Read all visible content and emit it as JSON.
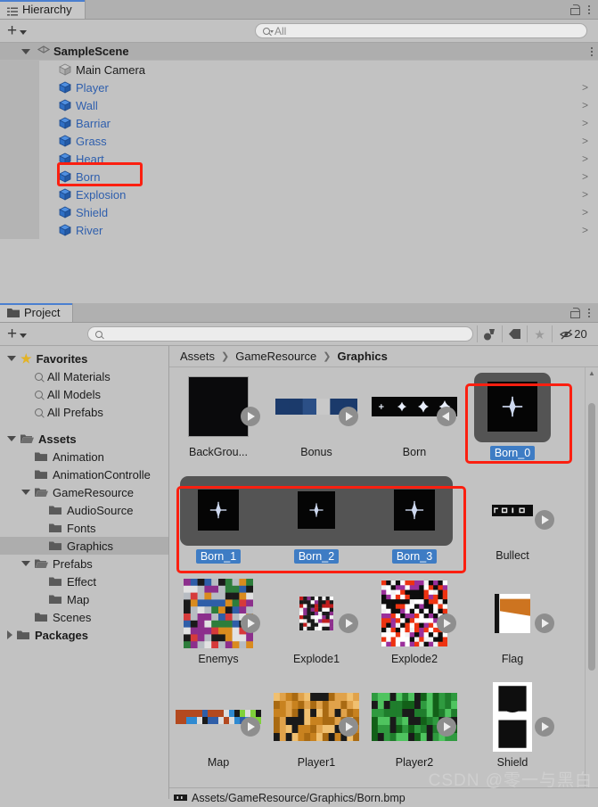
{
  "hierarchy": {
    "tab_label": "Hierarchy",
    "tab_icon": "hierarchy-icon",
    "add_label": "+",
    "search_placeholder": "All",
    "search_value": "",
    "scene_name": "SampleScene",
    "items": [
      {
        "label": "Main Camera",
        "type": "camera",
        "chevron": ""
      },
      {
        "label": "Player",
        "type": "prefab",
        "chevron": ">"
      },
      {
        "label": "Wall",
        "type": "prefab",
        "chevron": ">"
      },
      {
        "label": "Barriar",
        "type": "prefab",
        "chevron": ">"
      },
      {
        "label": "Grass",
        "type": "prefab",
        "chevron": ">"
      },
      {
        "label": "Heart",
        "type": "prefab",
        "chevron": ">"
      },
      {
        "label": "Born",
        "type": "prefab",
        "chevron": ">"
      },
      {
        "label": "Explosion",
        "type": "prefab",
        "chevron": ">"
      },
      {
        "label": "Shield",
        "type": "prefab",
        "chevron": ">"
      },
      {
        "label": "River",
        "type": "prefab",
        "chevron": ">"
      }
    ]
  },
  "project": {
    "tab_label": "Project",
    "add_label": "+",
    "search_placeholder": "",
    "search_value": "",
    "hidden_count": "20",
    "tree": [
      {
        "label": "Favorites",
        "kind": "favorites",
        "indent": 0,
        "arrow": "down",
        "bold": true
      },
      {
        "label": "All Materials",
        "kind": "search",
        "indent": 1,
        "arrow": "",
        "bold": false
      },
      {
        "label": "All Models",
        "kind": "search",
        "indent": 1,
        "arrow": "",
        "bold": false
      },
      {
        "label": "All Prefabs",
        "kind": "search",
        "indent": 1,
        "arrow": "",
        "bold": false
      },
      {
        "label": "",
        "kind": "spacer",
        "indent": 0,
        "arrow": "",
        "bold": false
      },
      {
        "label": "Assets",
        "kind": "folder-open",
        "indent": 0,
        "arrow": "down",
        "bold": true
      },
      {
        "label": "Animation",
        "kind": "folder",
        "indent": 1,
        "arrow": "",
        "bold": false
      },
      {
        "label": "AnimationControlle",
        "kind": "folder",
        "indent": 1,
        "arrow": "",
        "bold": false
      },
      {
        "label": "GameResource",
        "kind": "folder-open",
        "indent": 1,
        "arrow": "down",
        "bold": false
      },
      {
        "label": "AudioSource",
        "kind": "folder",
        "indent": 2,
        "arrow": "",
        "bold": false
      },
      {
        "label": "Fonts",
        "kind": "folder",
        "indent": 2,
        "arrow": "",
        "bold": false
      },
      {
        "label": "Graphics",
        "kind": "folder",
        "indent": 2,
        "arrow": "",
        "bold": false,
        "selected": true
      },
      {
        "label": "Prefabs",
        "kind": "folder-open",
        "indent": 1,
        "arrow": "down",
        "bold": false
      },
      {
        "label": "Effect",
        "kind": "folder",
        "indent": 2,
        "arrow": "",
        "bold": false
      },
      {
        "label": "Map",
        "kind": "folder",
        "indent": 2,
        "arrow": "",
        "bold": false
      },
      {
        "label": "Scenes",
        "kind": "folder",
        "indent": 1,
        "arrow": "",
        "bold": false
      },
      {
        "label": "Packages",
        "kind": "folder",
        "indent": 0,
        "arrow": "right",
        "bold": true
      }
    ],
    "breadcrumb": [
      {
        "label": "Assets",
        "current": false
      },
      {
        "label": "GameResource",
        "current": false
      },
      {
        "label": "Graphics",
        "current": true
      }
    ],
    "grid_rows": [
      [
        {
          "label": "BackGrou...",
          "art": "background",
          "play": true,
          "selected": false
        },
        {
          "label": "Bonus",
          "art": "bonus",
          "play": true,
          "selected": false
        },
        {
          "label": "Born",
          "art": "bornsheet",
          "play": true,
          "play_left": true,
          "selected": false
        },
        {
          "label": "Born_0",
          "art": "born0",
          "play": false,
          "selected": true
        }
      ],
      [
        {
          "label": "Born_1",
          "art": "born1",
          "play": false,
          "selected": true
        },
        {
          "label": "Born_2",
          "art": "born2",
          "play": false,
          "selected": true
        },
        {
          "label": "Born_3",
          "art": "born3",
          "play": false,
          "selected": true
        },
        {
          "label": "Bullect",
          "art": "bullet",
          "play": true,
          "selected": false
        }
      ],
      [
        {
          "label": "Enemys",
          "art": "enemys",
          "play": true,
          "selected": false
        },
        {
          "label": "Explode1",
          "art": "explode1",
          "play": true,
          "selected": false
        },
        {
          "label": "Explode2",
          "art": "explode2",
          "play": true,
          "selected": false
        },
        {
          "label": "Flag",
          "art": "flag",
          "play": true,
          "selected": false
        }
      ],
      [
        {
          "label": "Map",
          "art": "map",
          "play": true,
          "selected": false
        },
        {
          "label": "Player1",
          "art": "player1",
          "play": true,
          "selected": false
        },
        {
          "label": "Player2",
          "art": "player2",
          "play": true,
          "selected": false
        },
        {
          "label": "Shield",
          "art": "shield",
          "play": true,
          "selected": false
        }
      ]
    ],
    "status_path": "Assets/GameResource/Graphics/Born.bmp"
  },
  "watermark": "CSDN @零一与黑白",
  "colors": {
    "accent_blue": "#3e7cc4",
    "prefab_blue": "#2f5fad",
    "highlight_red": "#fb1f10",
    "panel_bg": "#c2c2c2",
    "selection_gray": "#545454"
  }
}
